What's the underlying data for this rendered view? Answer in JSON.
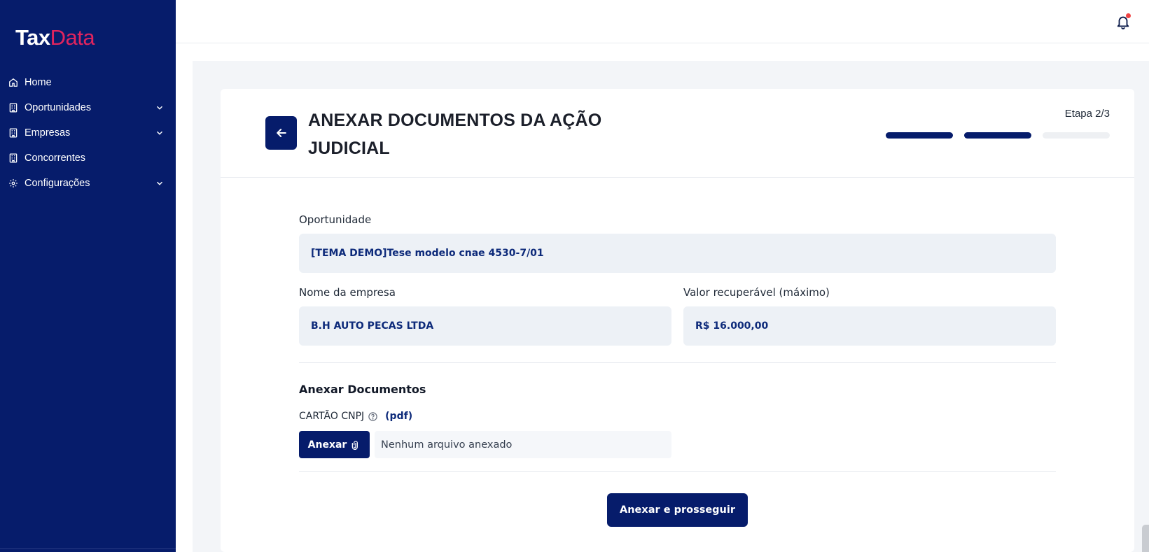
{
  "app": {
    "logo_part1": "Tax",
    "logo_part2": "Data",
    "brand_color": "#061c6b",
    "accent_color": "#e0245e"
  },
  "sidebar": {
    "toggle_icon": "sidebar-panel-icon",
    "items": [
      {
        "label": "Home",
        "icon": "home-icon",
        "expandable": false
      },
      {
        "label": "Oportunidades",
        "icon": "building-icon",
        "expandable": true
      },
      {
        "label": "Empresas",
        "icon": "building-icon",
        "expandable": true
      },
      {
        "label": "Concorrentes",
        "icon": "building-icon",
        "expandable": false
      },
      {
        "label": "Configurações",
        "icon": "gear-icon",
        "expandable": true
      }
    ]
  },
  "header": {
    "notification_icon": "bell-icon",
    "has_unread": true
  },
  "page": {
    "title": "ANEXAR DOCUMENTOS DA AÇÃO JUDICIAL",
    "step_label": "Etapa 2/3",
    "steps_total": 3,
    "steps_done": 2
  },
  "form": {
    "opportunity_label": "Oportunidade",
    "opportunity_value": "[TEMA DEMO]Tese modelo cnae 4530-7/01",
    "company_label": "Nome da empresa",
    "company_value": "B.H AUTO PECAS LTDA",
    "recoverable_label": "Valor recuperável (máximo)",
    "recoverable_value": "R$ 16.000,00"
  },
  "attachments": {
    "section_title": "Anexar Documentos",
    "doc_name": "CARTÃO CNPJ",
    "doc_ext": "(pdf)",
    "attach_button": "Anexar",
    "file_status": "Nenhum arquivo anexado",
    "submit_button": "Anexar e prosseguir"
  }
}
